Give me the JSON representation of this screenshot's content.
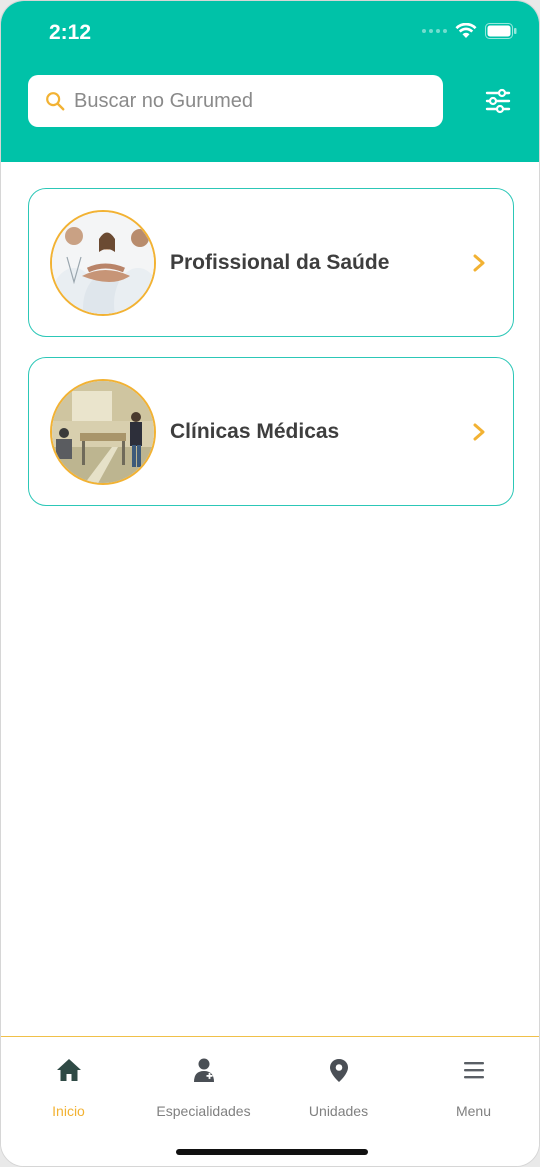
{
  "status_bar": {
    "time": "2:12"
  },
  "search": {
    "placeholder": "Buscar no Gurumed"
  },
  "cards": [
    {
      "label": "Profissional da Saúde"
    },
    {
      "label": "Clínicas Médicas"
    }
  ],
  "bottom_nav": {
    "items": [
      {
        "label": "Inicio",
        "icon": "home-icon",
        "active": true
      },
      {
        "label": "Especialidades",
        "icon": "doctor-icon",
        "active": false
      },
      {
        "label": "Unidades",
        "icon": "location-pin-icon",
        "active": false
      },
      {
        "label": "Menu",
        "icon": "menu-icon",
        "active": false
      }
    ]
  },
  "colors": {
    "header": "#00c2a8",
    "accent": "#f2b233",
    "card_border": "#2cc7b7",
    "nav_icon": "#2f4a45"
  }
}
